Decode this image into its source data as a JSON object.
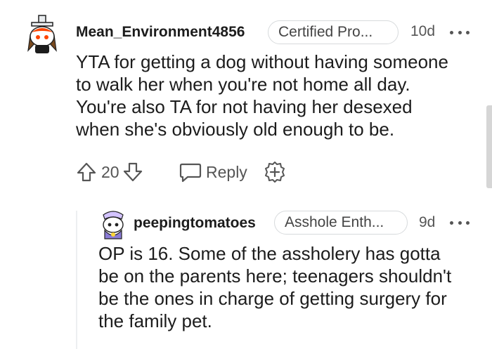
{
  "comments": [
    {
      "username": "Mean_Environment4856",
      "flair": "Certified Pro...",
      "age": "10d",
      "body_lines": [
        "YTA for getting a dog without having someone",
        "to walk her when you're not home all day.",
        "You're also TA for not having her desexed",
        "when she's obviously old enough to be."
      ],
      "votes": "20",
      "reply_label": "Reply"
    },
    {
      "username": "peepingtomatoes",
      "flair": "Asshole Enth...",
      "age": "9d",
      "body_lines": [
        "OP is 16. Some of the assholery has gotta",
        "be on the parents here; teenagers shouldn't",
        "be the ones in charge of getting surgery for",
        "the family pet."
      ]
    }
  ],
  "icons": {
    "upvote": "arrow-up-icon",
    "downvote": "arrow-down-icon",
    "reply": "speech-bubble-icon",
    "award": "plus-circle-icon",
    "more": "ellipsis-icon"
  },
  "colors": {
    "avatar1_accent": "#ff4500",
    "avatar2_accent": "#8a7bd6",
    "text": "#1c1c1c",
    "muted": "#555555"
  }
}
